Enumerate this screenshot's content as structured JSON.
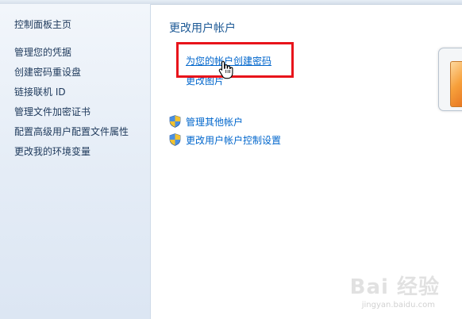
{
  "sidebar": {
    "home": "控制面板主页",
    "items": [
      {
        "label": "管理您的凭据"
      },
      {
        "label": "创建密码重设盘"
      },
      {
        "label": "链接联机 ID"
      },
      {
        "label": "管理文件加密证书"
      },
      {
        "label": "配置高级用户配置文件属性"
      },
      {
        "label": "更改我的环境变量"
      }
    ]
  },
  "main": {
    "title": "更改用户帐户",
    "links": {
      "create_password": "为您的帐户创建密码",
      "change_picture": "更改图片"
    },
    "tasks": [
      {
        "label": "管理其他帐户",
        "icon": "uac-shield-icon"
      },
      {
        "label": "更改用户帐户控制设置",
        "icon": "uac-shield-icon"
      }
    ]
  },
  "watermark": {
    "logo": "Bai 经验",
    "url": "jingyan.baidu.com"
  },
  "colors": {
    "link": "#0066cc",
    "heading": "#1e5a96",
    "highlight_box": "#e8141b",
    "sidebar_text": "#1e395b"
  }
}
